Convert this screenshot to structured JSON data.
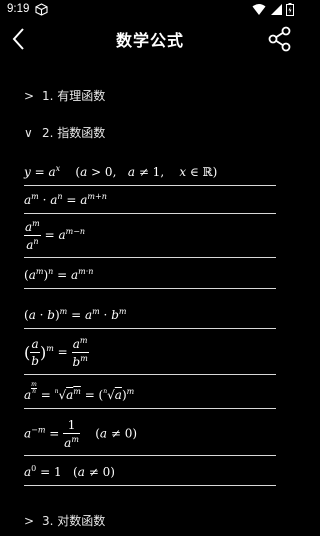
{
  "status_bar": {
    "time": "9:19"
  },
  "header": {
    "title": "数学公式"
  },
  "sections": [
    {
      "chevron": ">",
      "label": "1. 有理函数",
      "expanded": false
    },
    {
      "chevron": "∨",
      "label": "2. 指数函数",
      "expanded": true
    },
    {
      "chevron": ">",
      "label": "3. 对数函数",
      "expanded": false
    }
  ],
  "formulas": [
    "y = a^x   (a > 0,  a ≠ 1,  x ∈ ℝ)",
    "a^m · a^n = a^(m+n)",
    "a^m / a^n = a^(m−n)",
    "(a^m)^n = a^(m·n)",
    "(a · b)^m = a^m · b^m",
    "(a / b)^m = a^m / b^m",
    "a^(m/n) = ⁿ√(a^m) = (ⁿ√a)^m",
    "a^(−m) = 1 / a^m   (a ≠ 0)",
    "a^0 = 1   (a ≠ 0)"
  ]
}
